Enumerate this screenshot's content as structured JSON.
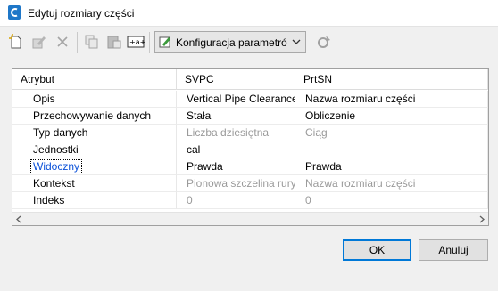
{
  "window": {
    "title": "Edytuj rozmiary części"
  },
  "toolbar": {
    "buttons": [
      "new-icon",
      "edit-icon",
      "delete-icon",
      "copy-icon",
      "paste-icon",
      "rename-icon"
    ],
    "config_label": "Konfiguracja parametró",
    "settings_icon": "settings-icon"
  },
  "grid": {
    "headers": [
      "Atrybut",
      "SVPC",
      "PrtSN"
    ],
    "rows": [
      {
        "label": "Opis",
        "v1": "Vertical Pipe Clearance",
        "v2": "Nazwa rozmiaru części",
        "dim": false
      },
      {
        "label": "Przechowywanie danych",
        "v1": "Stała",
        "v2": "Obliczenie",
        "dim": false
      },
      {
        "label": "Typ danych",
        "v1": "Liczba dziesiętna",
        "v2": "Ciąg",
        "dim": true
      },
      {
        "label": "Jednostki",
        "v1": "cal",
        "v2": "",
        "dim": false
      },
      {
        "label": "Widoczny",
        "v1": "Prawda",
        "v2": "Prawda",
        "dim": false,
        "selected": true
      },
      {
        "label": "Kontekst",
        "v1": "Pionowa szczelina rury",
        "v2": "Nazwa rozmiaru części",
        "dim": true
      },
      {
        "label": "Indeks",
        "v1": "0",
        "v2": "0",
        "dim": true
      }
    ]
  },
  "buttons": {
    "ok": "OK",
    "cancel": "Anuluj"
  },
  "colors": {
    "accent": "#0078d7",
    "app_icon": "#1f77c8",
    "selected_text": "#0a50d8"
  }
}
